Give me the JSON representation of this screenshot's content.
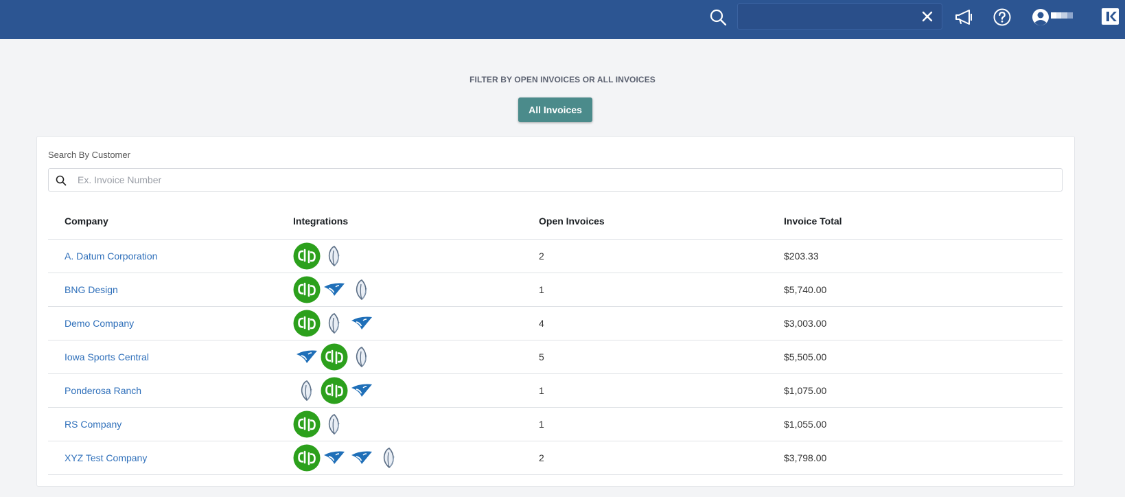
{
  "header": {
    "search_value": "",
    "icons": [
      "search-icon",
      "close-icon",
      "megaphone-icon",
      "help-icon",
      "user-account-icon",
      "app-logo-icon"
    ]
  },
  "filter": {
    "title": "FILTER BY OPEN INVOICES OR ALL INVOICES",
    "button_label": "All Invoices"
  },
  "search": {
    "label": "Search By Customer",
    "placeholder": "Ex. Invoice Number",
    "value": ""
  },
  "table": {
    "columns": [
      "Company",
      "Integrations",
      "Open Invoices",
      "Invoice Total"
    ],
    "rows": [
      {
        "company": "A. Datum Corporation",
        "integrations": [
          "quickbooks",
          "leaf"
        ],
        "open_invoices": "2",
        "invoice_total": "$203.33"
      },
      {
        "company": "BNG Design",
        "integrations": [
          "quickbooks",
          "wing",
          "leaf"
        ],
        "open_invoices": "1",
        "invoice_total": "$5,740.00"
      },
      {
        "company": "Demo Company",
        "integrations": [
          "quickbooks",
          "leaf",
          "wing"
        ],
        "open_invoices": "4",
        "invoice_total": "$3,003.00"
      },
      {
        "company": "Iowa Sports Central",
        "integrations": [
          "wing",
          "quickbooks",
          "leaf"
        ],
        "open_invoices": "5",
        "invoice_total": "$5,505.00"
      },
      {
        "company": "Ponderosa Ranch",
        "integrations": [
          "leaf",
          "quickbooks",
          "wing"
        ],
        "open_invoices": "1",
        "invoice_total": "$1,075.00"
      },
      {
        "company": "RS Company",
        "integrations": [
          "quickbooks",
          "leaf"
        ],
        "open_invoices": "1",
        "invoice_total": "$1,055.00"
      },
      {
        "company": "XYZ Test Company",
        "integrations": [
          "quickbooks",
          "wing",
          "wing",
          "leaf"
        ],
        "open_invoices": "2",
        "invoice_total": "$3,798.00"
      }
    ]
  },
  "colors": {
    "header_bg": "#2c5592",
    "button_bg": "#4b8b8b",
    "link": "#2e6fba",
    "quickbooks_green": "#2ca01c",
    "wing_blue": "#1f6fb8"
  }
}
